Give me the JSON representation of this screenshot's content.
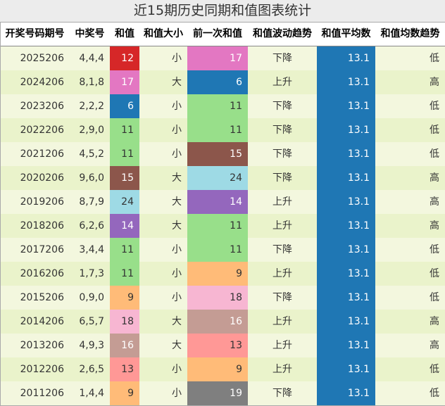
{
  "chart_data": {
    "type": "table",
    "title": "近15期历史同期和值图表统计",
    "columns": [
      "开奖号码期号",
      "中奖号",
      "和值",
      "和值大小",
      "前一次和值",
      "和值波动趋势",
      "和值平均数",
      "和值均数趋势"
    ],
    "rows": [
      {
        "period": "2025206",
        "numbers": "4,4,4",
        "sum": 12,
        "size": "小",
        "prev_sum": 17,
        "trend": "下降",
        "avg": "13.1",
        "avg_trend": "低"
      },
      {
        "period": "2024206",
        "numbers": "8,1,8",
        "sum": 17,
        "size": "大",
        "prev_sum": 6,
        "trend": "上升",
        "avg": "13.1",
        "avg_trend": "高"
      },
      {
        "period": "2023206",
        "numbers": "2,2,2",
        "sum": 6,
        "size": "小",
        "prev_sum": 11,
        "trend": "下降",
        "avg": "13.1",
        "avg_trend": "低"
      },
      {
        "period": "2022206",
        "numbers": "2,9,0",
        "sum": 11,
        "size": "小",
        "prev_sum": 11,
        "trend": "下降",
        "avg": "13.1",
        "avg_trend": "低"
      },
      {
        "period": "2021206",
        "numbers": "4,5,2",
        "sum": 11,
        "size": "小",
        "prev_sum": 15,
        "trend": "下降",
        "avg": "13.1",
        "avg_trend": "低"
      },
      {
        "period": "2020206",
        "numbers": "9,6,0",
        "sum": 15,
        "size": "大",
        "prev_sum": 24,
        "trend": "下降",
        "avg": "13.1",
        "avg_trend": "高"
      },
      {
        "period": "2019206",
        "numbers": "8,7,9",
        "sum": 24,
        "size": "大",
        "prev_sum": 14,
        "trend": "上升",
        "avg": "13.1",
        "avg_trend": "高"
      },
      {
        "period": "2018206",
        "numbers": "6,2,6",
        "sum": 14,
        "size": "大",
        "prev_sum": 11,
        "trend": "上升",
        "avg": "13.1",
        "avg_trend": "高"
      },
      {
        "period": "2017206",
        "numbers": "3,4,4",
        "sum": 11,
        "size": "小",
        "prev_sum": 11,
        "trend": "下降",
        "avg": "13.1",
        "avg_trend": "低"
      },
      {
        "period": "2016206",
        "numbers": "1,7,3",
        "sum": 11,
        "size": "小",
        "prev_sum": 9,
        "trend": "上升",
        "avg": "13.1",
        "avg_trend": "低"
      },
      {
        "period": "2015206",
        "numbers": "0,9,0",
        "sum": 9,
        "size": "小",
        "prev_sum": 18,
        "trend": "下降",
        "avg": "13.1",
        "avg_trend": "低"
      },
      {
        "period": "2014206",
        "numbers": "6,5,7",
        "sum": 18,
        "size": "大",
        "prev_sum": 16,
        "trend": "上升",
        "avg": "13.1",
        "avg_trend": "高"
      },
      {
        "period": "2013206",
        "numbers": "4,9,3",
        "sum": 16,
        "size": "大",
        "prev_sum": 13,
        "trend": "上升",
        "avg": "13.1",
        "avg_trend": "高"
      },
      {
        "period": "2012206",
        "numbers": "2,6,5",
        "sum": 13,
        "size": "小",
        "prev_sum": 9,
        "trend": "上升",
        "avg": "13.1",
        "avg_trend": "低"
      },
      {
        "period": "2011206",
        "numbers": "1,4,4",
        "sum": 9,
        "size": "小",
        "prev_sum": 19,
        "trend": "下降",
        "avg": "13.1",
        "avg_trend": "低"
      }
    ],
    "sum_colors": {
      "6": "#1f77b4",
      "9": "#ffbb78",
      "11": "#98df8a",
      "12": "#d62728",
      "13": "#ff9896",
      "14": "#9467bd",
      "15": "#8c564b",
      "16": "#c49c94",
      "17": "#e377c2",
      "18": "#f7b6d2",
      "19": "#7f7f7f",
      "24": "#9edae5"
    },
    "light_text_sums": [
      6,
      12,
      14,
      15,
      16,
      17,
      19
    ],
    "stripe_colors": [
      "#f3f7de",
      "#eaf3cb"
    ],
    "avg_color": "#1f77b4"
  }
}
